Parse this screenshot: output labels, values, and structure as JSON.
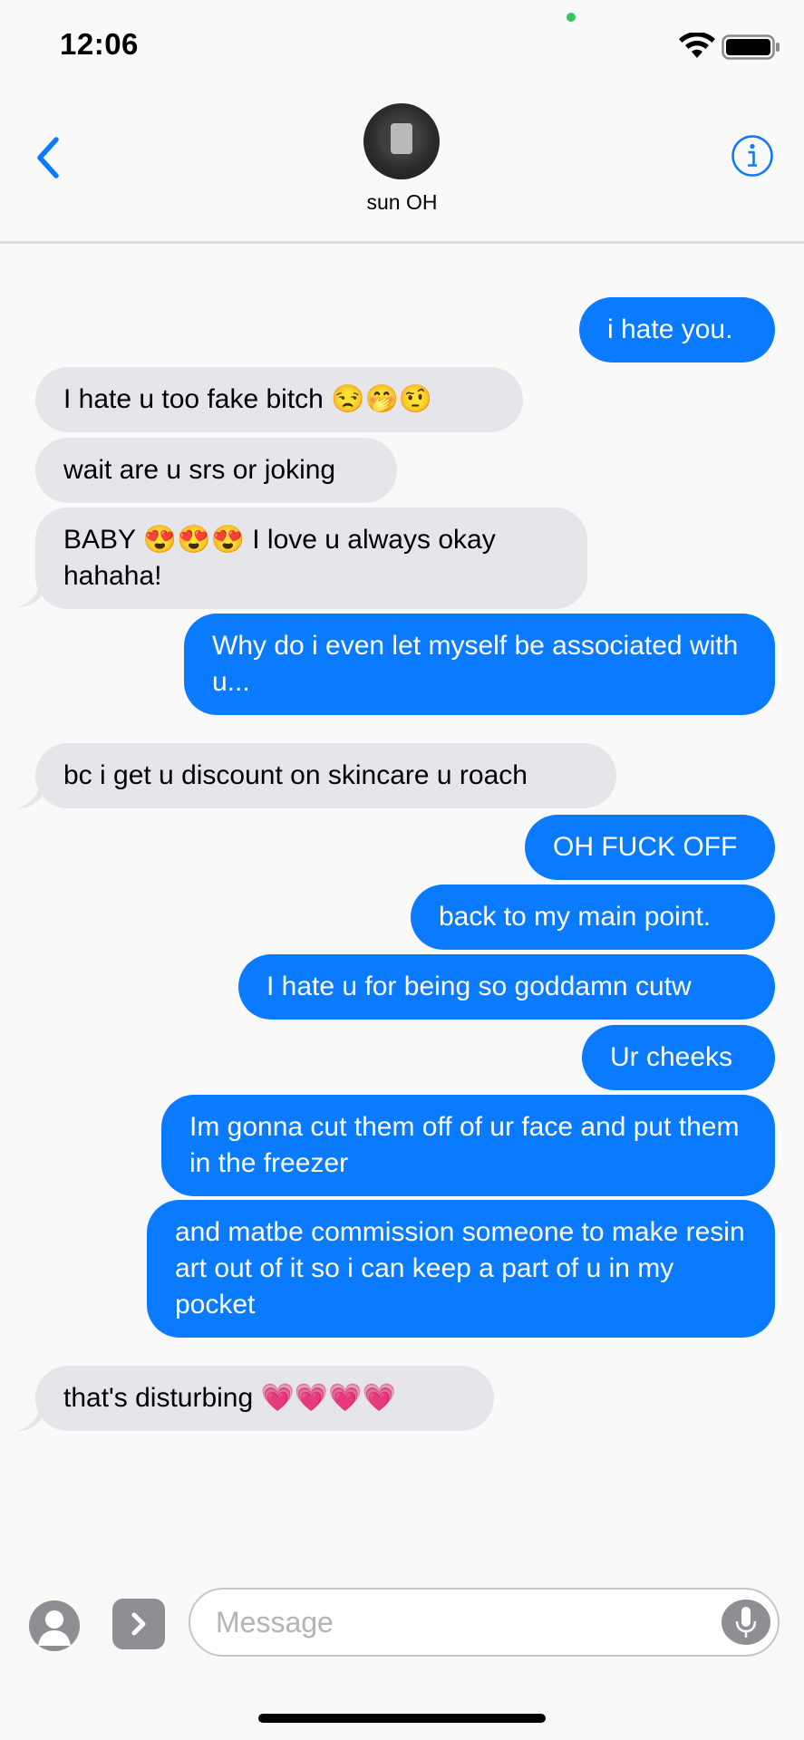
{
  "status_bar": {
    "time": "12:06"
  },
  "header": {
    "contact_name": "sun OH"
  },
  "messages": [
    {
      "from": "me",
      "text": "i hate you."
    },
    {
      "from": "them",
      "text": "I hate u too fake bitch 😒🤭🤨"
    },
    {
      "from": "them",
      "text": "wait are u srs or joking"
    },
    {
      "from": "them",
      "text": "BABY 😍😍😍 I love u always okay hahaha!"
    },
    {
      "from": "me",
      "text": "Why do i even let myself be associated with u..."
    },
    {
      "from": "them",
      "text": "bc i get u discount on skincare u roach"
    },
    {
      "from": "me",
      "text": "OH FUCK OFF"
    },
    {
      "from": "me",
      "text": "back to my main point."
    },
    {
      "from": "me",
      "text": "I hate u for being so goddamn cutw"
    },
    {
      "from": "me",
      "text": "Ur cheeks"
    },
    {
      "from": "me",
      "text": "Im gonna cut them off of ur face and put them in the freezer"
    },
    {
      "from": "me",
      "text": "and matbe commission someone to make resin art out of it so i can keep a part of u in my pocket"
    },
    {
      "from": "them",
      "text": "that's disturbing 💗💗💗💗"
    }
  ],
  "composer": {
    "placeholder": "Message",
    "value": ""
  },
  "colors": {
    "outgoing": "#0a7aff",
    "incoming": "#e6e5ea",
    "accent": "#0a7aff"
  },
  "icons": [
    "back-chevron-icon",
    "info-icon",
    "contact-icon",
    "apps-chevron-icon",
    "microphone-icon",
    "wifi-icon",
    "battery-icon"
  ]
}
